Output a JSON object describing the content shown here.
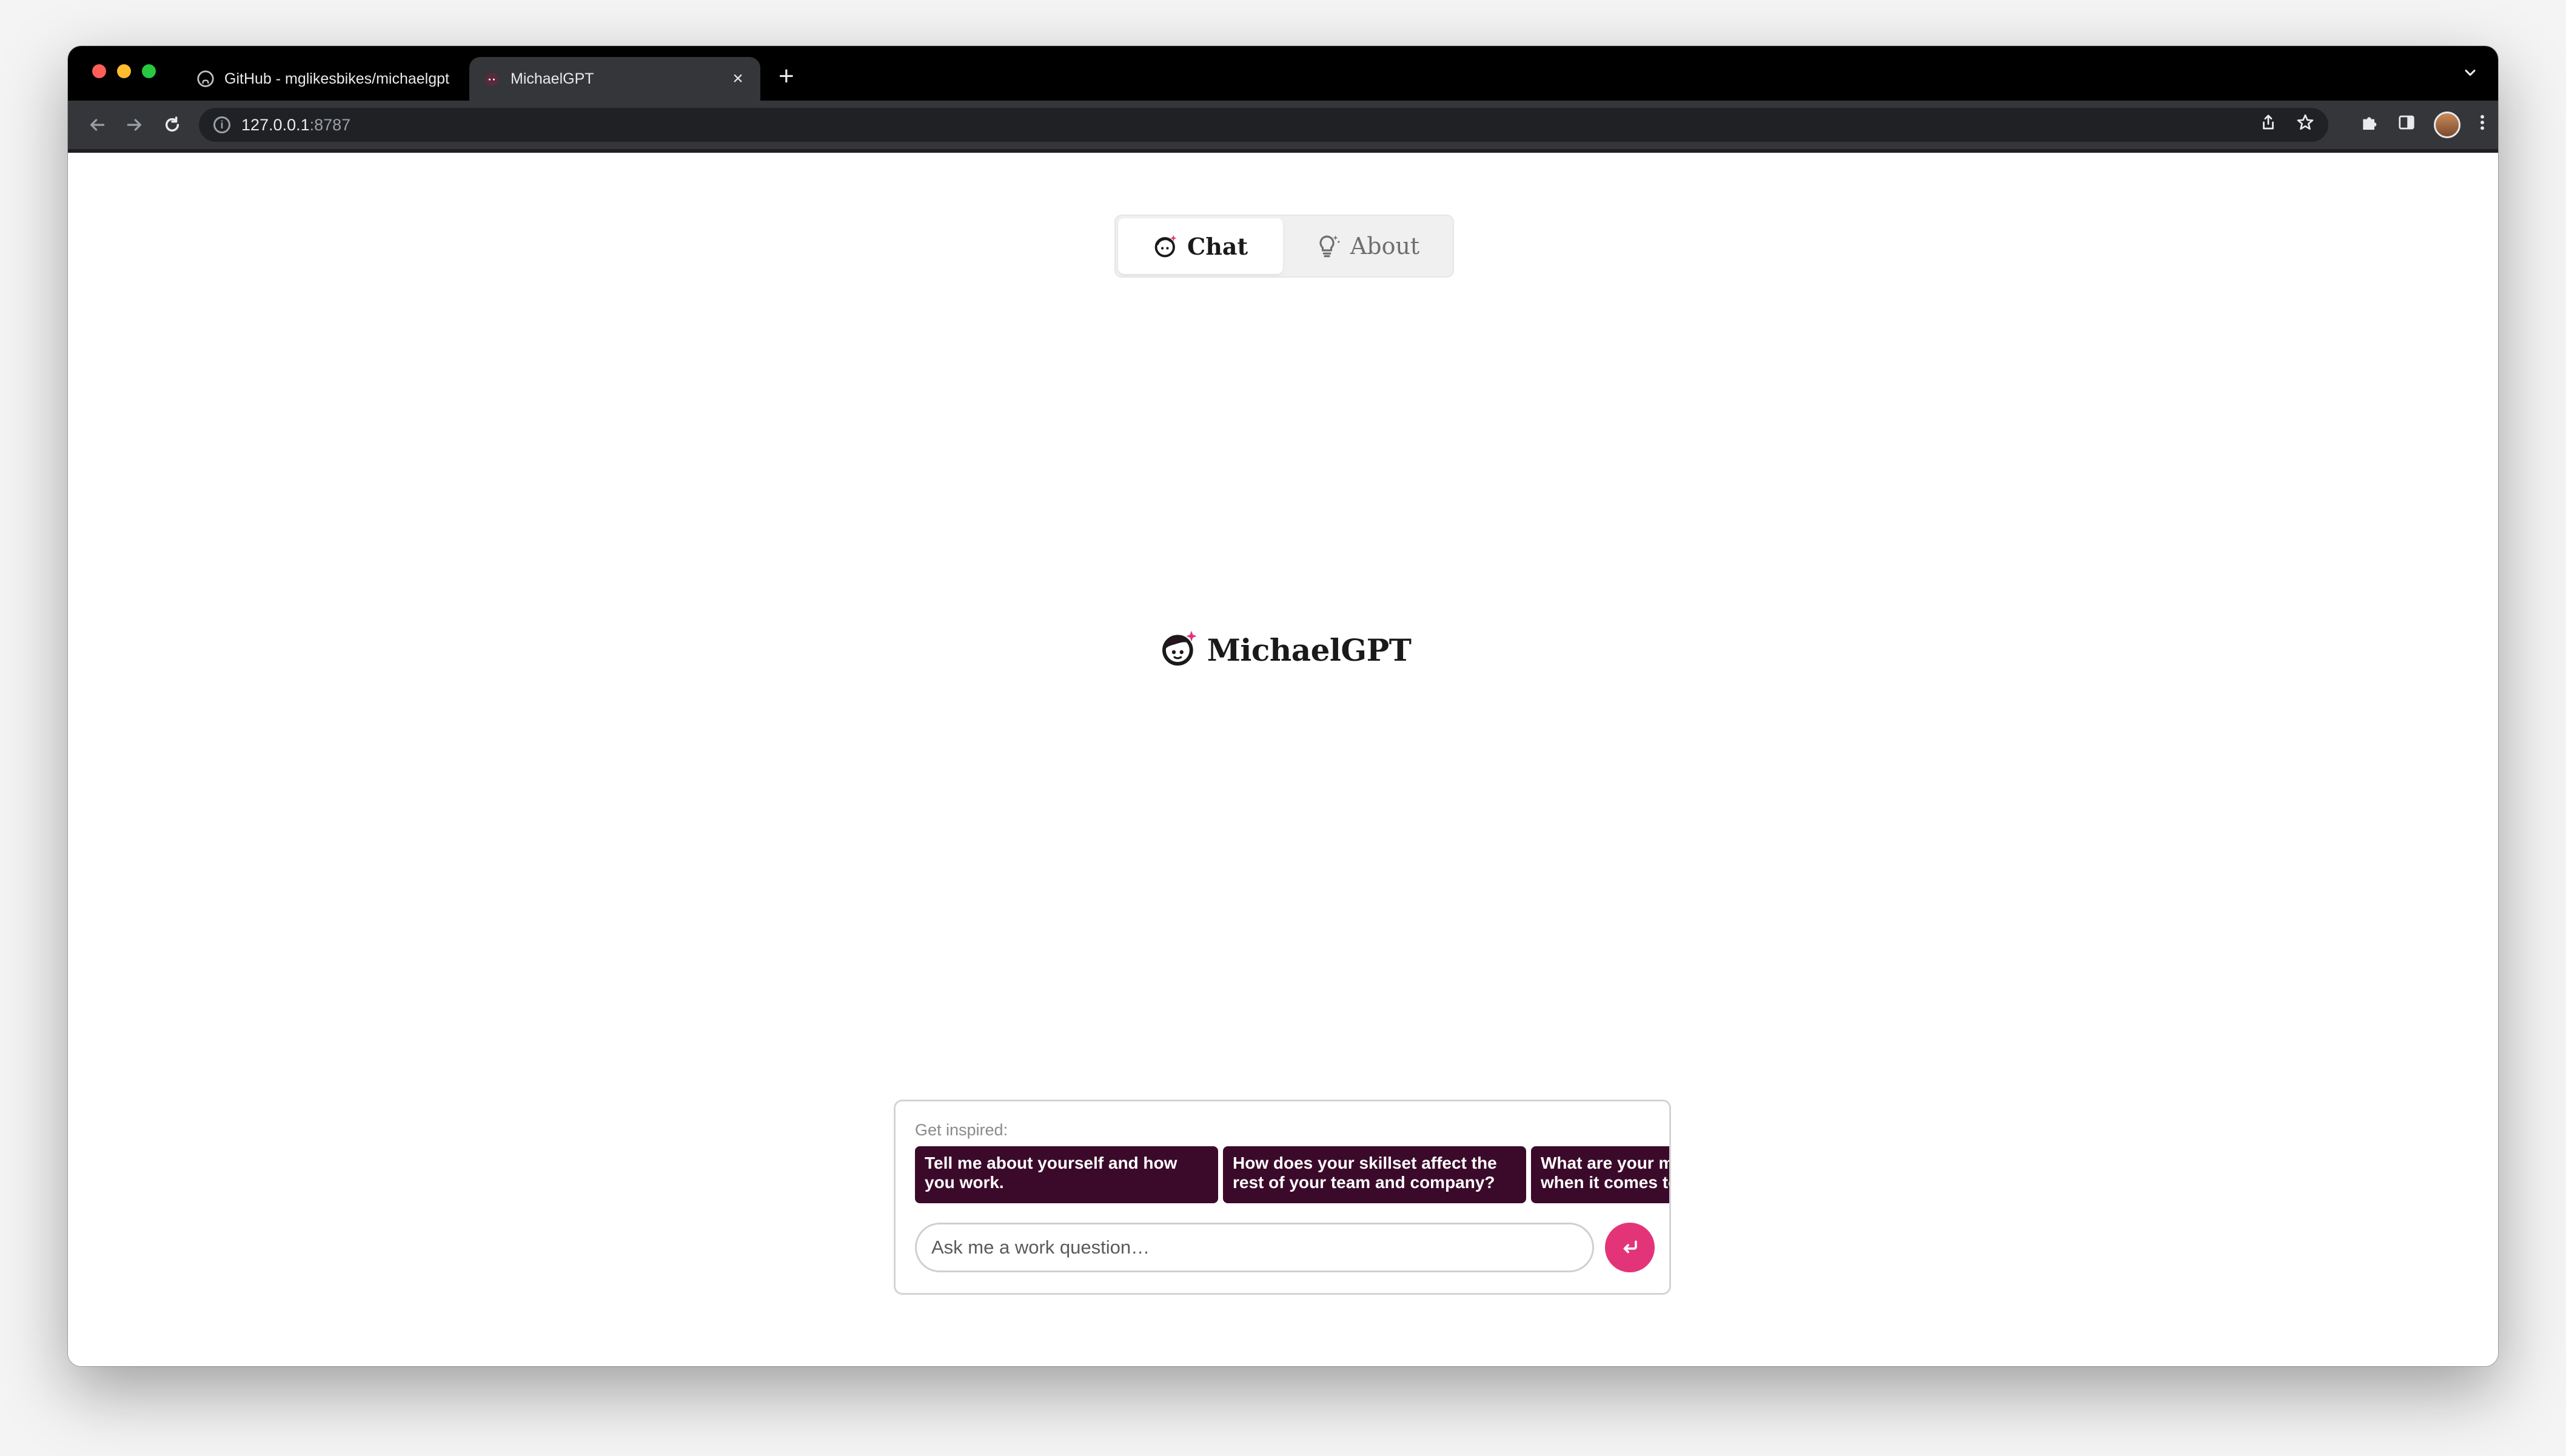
{
  "browser": {
    "tabs": [
      {
        "title": "GitHub - mglikesbikes/michaelgpt",
        "favicon": "github-icon",
        "active": false
      },
      {
        "title": "MichaelGPT",
        "favicon": "michaelgpt-logo-icon",
        "active": true
      }
    ],
    "close_glyph": "×",
    "new_tab_glyph": "+",
    "tab_menu_glyph": "⌄",
    "url_host": "127.0.0.1",
    "url_port": ":8787",
    "info_glyph": "i"
  },
  "nav": {
    "chat_label": "Chat",
    "about_label": "About"
  },
  "hero": {
    "title": "MichaelGPT"
  },
  "chatbox": {
    "inspired_label": "Get inspired:",
    "suggestions": [
      "Tell me about yourself and how\nyou work.",
      "How does your skillset affect the\nrest of your team and company?",
      "What are your main strengths\nwhen it comes to work?"
    ],
    "input_placeholder": "Ask me a work question…",
    "send_glyph": "↵"
  },
  "colors": {
    "accent": "#e3347a",
    "suggestion_bg": "#3b0a2a",
    "chrome_dark": "#35363a"
  }
}
